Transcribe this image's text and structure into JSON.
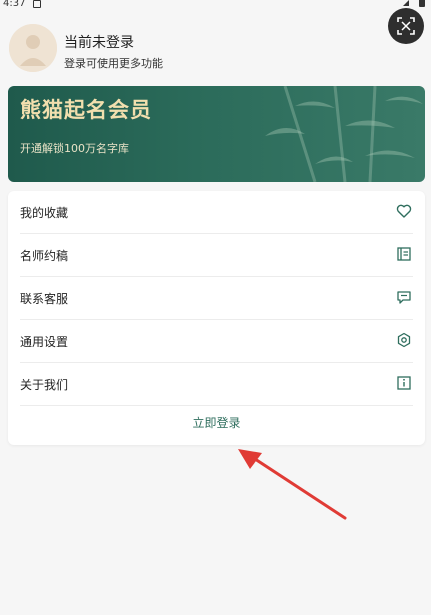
{
  "status_bar": {
    "time": "4:37"
  },
  "header": {
    "title": "当前未登录",
    "subtitle": "登录可使用更多功能"
  },
  "vip_card": {
    "title": "熊猫起名会员",
    "subtitle": "开通解锁100万名字库"
  },
  "menu": {
    "items": [
      {
        "label": "我的收藏",
        "icon": "heart-icon"
      },
      {
        "label": "名师约稿",
        "icon": "document-icon"
      },
      {
        "label": "联系客服",
        "icon": "chat-icon"
      },
      {
        "label": "通用设置",
        "icon": "settings-icon"
      },
      {
        "label": "关于我们",
        "icon": "info-icon"
      }
    ],
    "login_button": "立即登录"
  },
  "colors": {
    "accent": "#2f6e5e",
    "vip_bg": "#2b6b5a",
    "vip_title": "#f2dfae",
    "annotation_arrow": "#e03b35"
  }
}
